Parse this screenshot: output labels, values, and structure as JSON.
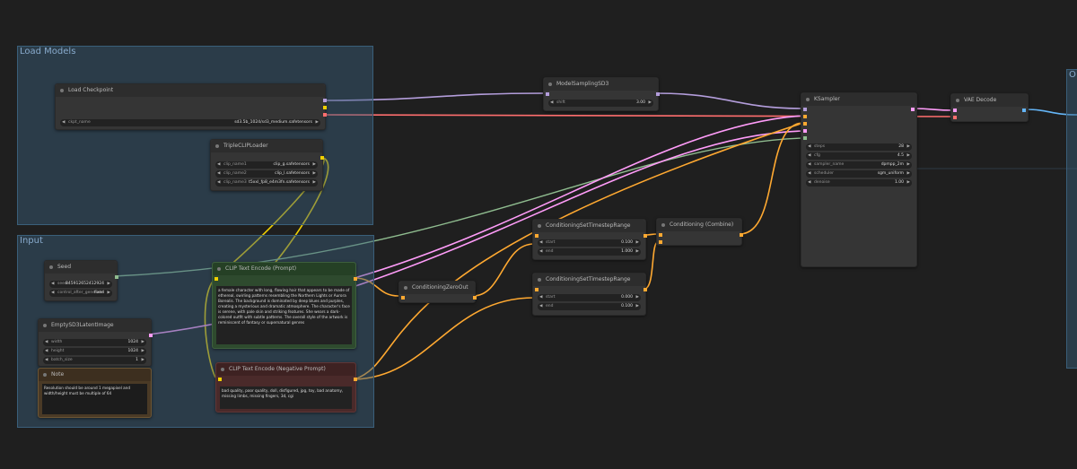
{
  "groups": {
    "load_models": {
      "title": "Load Models"
    },
    "input": {
      "title": "Input"
    },
    "right_group": {
      "title": "O"
    }
  },
  "nodes": {
    "load_checkpoint": {
      "title": "Load Checkpoint",
      "ckpt_label": "ckpt_name",
      "ckpt_value": "sd3.5b_1024/sd3_medium.safetensors"
    },
    "triple_clip": {
      "title": "TripleCLIPLoader",
      "widgets": [
        {
          "label": "clip_name1",
          "value": "clip_g.safetensors"
        },
        {
          "label": "clip_name2",
          "value": "clip_l.safetensors"
        },
        {
          "label": "clip_name3",
          "value": "t5xxl_fp8_e4m3fn.safetensors"
        }
      ]
    },
    "seed": {
      "title": "Seed",
      "widgets": [
        {
          "label": "seed",
          "value": "845912652412924"
        },
        {
          "label": "control_after_generate",
          "value": "fixed"
        }
      ]
    },
    "empty_latent": {
      "title": "EmptySD3LatentImage",
      "widgets": [
        {
          "label": "width",
          "value": "1024"
        },
        {
          "label": "height",
          "value": "1024"
        },
        {
          "label": "batch_size",
          "value": "1"
        }
      ]
    },
    "note": {
      "title": "Note",
      "text": "Resolution should be around 1 megapixel and width/height must be multiple of 64"
    },
    "clip_pos": {
      "title": "CLIP Text Encode (Prompt)",
      "text": "a female character with long, flowing hair that appears to be made of ethereal, swirling patterns resembling the Northern Lights or Aurora Borealis. The background is dominated by deep blues and purples, creating a mysterious and dramatic atmosphere. The character's face is serene, with pale skin and striking features. She wears a dark-colored outfit with subtle patterns. The overall style of the artwork is reminiscent of fantasy or supernatural genres"
    },
    "clip_neg": {
      "title": "CLIP Text Encode (Negative Prompt)",
      "text": "bad quality, poor quality, doll, disfigured, jpg, toy, bad anatomy, missing limbs, missing fingers, 3d, cgi"
    },
    "cond_zero": {
      "title": "ConditioningZeroOut"
    },
    "model_sampling": {
      "title": "ModelSamplingSD3",
      "widgets": [
        {
          "label": "shift",
          "value": "3.00"
        }
      ]
    },
    "cond_range1": {
      "title": "ConditioningSetTimestepRange",
      "widgets": [
        {
          "label": "start",
          "value": "0.100"
        },
        {
          "label": "end",
          "value": "1.000"
        }
      ]
    },
    "cond_range2": {
      "title": "ConditioningSetTimestepRange",
      "widgets": [
        {
          "label": "start",
          "value": "0.000"
        },
        {
          "label": "end",
          "value": "0.100"
        }
      ]
    },
    "cond_combine": {
      "title": "Conditioning (Combine)"
    },
    "ksampler": {
      "title": "KSampler",
      "widgets": [
        {
          "label": "steps",
          "value": "28"
        },
        {
          "label": "cfg",
          "value": "4.5"
        },
        {
          "label": "sampler_name",
          "value": "dpmpp_2m"
        },
        {
          "label": "scheduler",
          "value": "sgm_uniform"
        },
        {
          "label": "denoise",
          "value": "1.00"
        }
      ]
    },
    "vae_decode": {
      "title": "VAE Decode"
    }
  },
  "colors": {
    "model": "#b39ddb",
    "clip": "#f0d000",
    "vae": "#ff6e6e",
    "conditioning": "#ffa931",
    "latent": "#ff9cf9",
    "image": "#64b5f6",
    "int": "#8fbc8f"
  },
  "icons": {
    "arrow_left": "◀",
    "arrow_right": "▶"
  }
}
